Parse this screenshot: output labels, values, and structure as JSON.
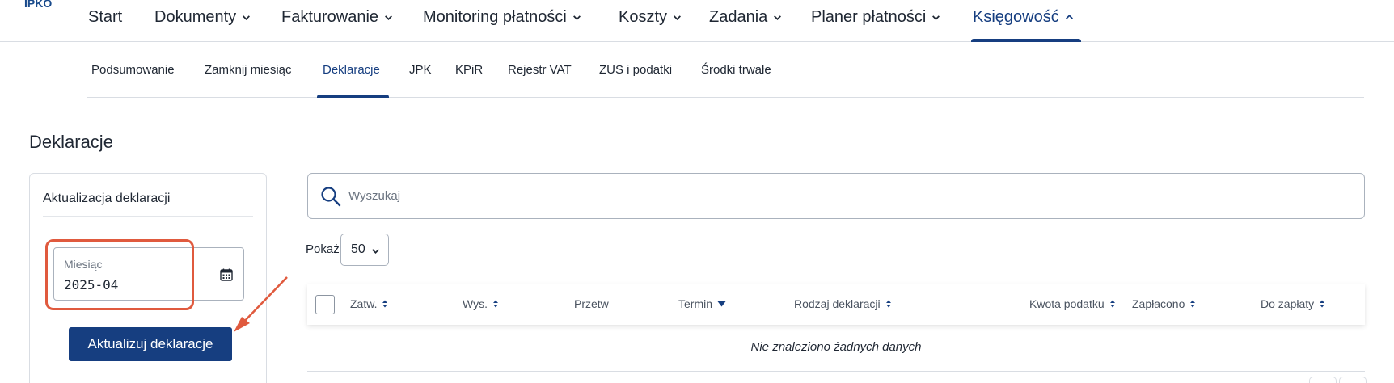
{
  "logo": "IPKO",
  "topnav": [
    {
      "label": "Start",
      "dropdown": false,
      "active": false
    },
    {
      "label": "Dokumenty",
      "dropdown": true,
      "active": false
    },
    {
      "label": "Fakturowanie",
      "dropdown": true,
      "active": false
    },
    {
      "label": "Monitoring płatności",
      "dropdown": true,
      "active": false
    },
    {
      "label": "Koszty",
      "dropdown": true,
      "active": false
    },
    {
      "label": "Zadania",
      "dropdown": true,
      "active": false
    },
    {
      "label": "Planer płatności",
      "dropdown": true,
      "active": false
    },
    {
      "label": "Księgowość",
      "dropdown": true,
      "active": true,
      "expanded": true
    }
  ],
  "subnav": [
    {
      "label": "Podsumowanie",
      "active": false
    },
    {
      "label": "Zamknij miesiąc",
      "active": false
    },
    {
      "label": "Deklaracje",
      "active": true
    },
    {
      "label": "JPK",
      "active": false
    },
    {
      "label": "KPiR",
      "active": false
    },
    {
      "label": "Rejestr VAT",
      "active": false
    },
    {
      "label": "ZUS i podatki",
      "active": false
    },
    {
      "label": "Środki trwałe",
      "active": false
    }
  ],
  "page_title": "Deklaracje",
  "update_panel": {
    "title": "Aktualizacja deklaracji",
    "month_label": "Miesiąc",
    "month_value": "2025-04",
    "button_label": "Aktualizuj deklaracje"
  },
  "search": {
    "placeholder": "Wyszukaj"
  },
  "page_size": {
    "label": "Pokaż",
    "value": "50"
  },
  "table": {
    "columns": [
      {
        "label": "Zatw.",
        "sort": "both"
      },
      {
        "label": "Wys.",
        "sort": "both"
      },
      {
        "label": "Przetw",
        "sort": "none"
      },
      {
        "label": "Termin",
        "sort": "desc"
      },
      {
        "label": "Rodzaj deklaracji",
        "sort": "both"
      },
      {
        "label": "Kwota podatku",
        "sort": "both"
      },
      {
        "label": "Zapłacono",
        "sort": "both"
      },
      {
        "label": "Do zapłaty",
        "sort": "both"
      }
    ],
    "empty_message": "Nie znaleziono żadnych danych"
  },
  "colors": {
    "brand": "#163e80",
    "annotation": "#e05a3e",
    "border": "#d9dde3",
    "text": "#1f2733"
  }
}
